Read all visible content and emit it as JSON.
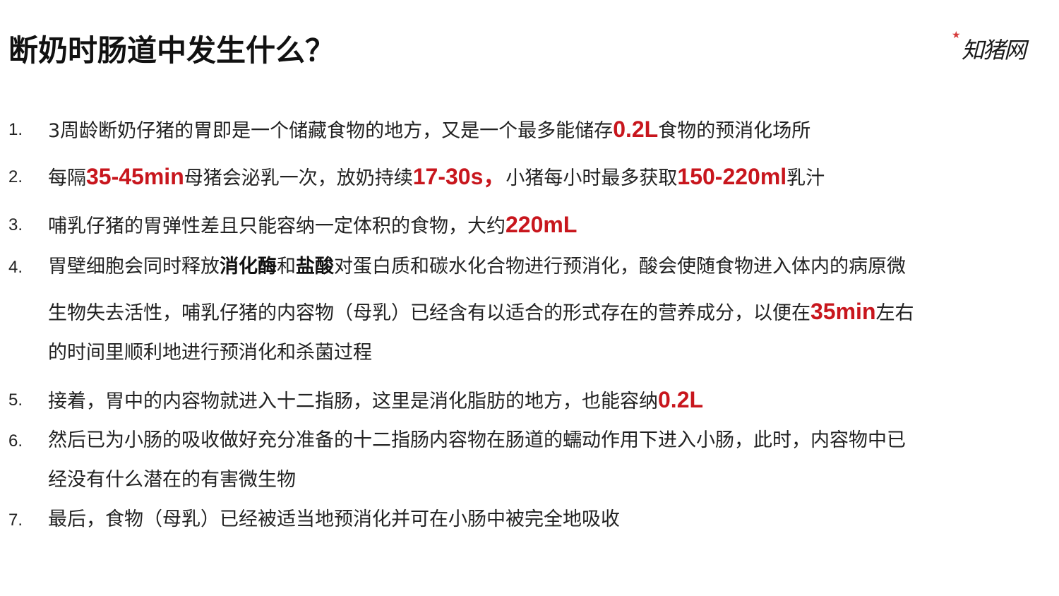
{
  "title": "断奶时肠道中发生什么？",
  "logo": {
    "text": "知猪网",
    "icon": "red-star-icon",
    "star_color": "#d63a3a"
  },
  "colors": {
    "highlight": "#c8161d",
    "text": "#222222"
  },
  "items": [
    {
      "number": "1.",
      "l1": {
        "a": "3周龄断奶仔猪的胃即是一个储藏食物的地方，又是一个最多能储存",
        "h1": "0.2L",
        "b": "食物的预消化场所"
      }
    },
    {
      "number": "2.",
      "l1": {
        "a": "每隔",
        "h1": "35-45min",
        "b": "母猪会泌乳一次，放奶持续",
        "h2": "17-30s，",
        "c": "小猪每小时最多获取",
        "h3": "150-220ml",
        "d": "乳汁"
      }
    },
    {
      "number": "3.",
      "l1": {
        "a": "哺乳仔猪的胃弹性差且只能容纳一定体积的食物，大约",
        "h1": "220mL"
      }
    },
    {
      "number": "4.",
      "l1": {
        "a": "胃壁细胞会同时释放",
        "b1": "消化酶",
        "b": "和",
        "b2": "盐酸",
        "c": "对蛋白质和碳水化合物进行预消化，酸会使随食物进入体内的病原微"
      },
      "l2": {
        "a": "生物失去活性，哺乳仔猪的内容物（母乳）已经含有以适合的形式存在的营养成分，以便在",
        "h1": "35min",
        "b": "左右"
      },
      "l3": {
        "a": "的时间里顺利地进行预消化和杀菌过程"
      }
    },
    {
      "number": "5.",
      "l1": {
        "a": "接着，胃中的内容物就进入十二指肠，这里是消化脂肪的地方，也能容纳",
        "h1": "0.2L"
      }
    },
    {
      "number": "6.",
      "l1": {
        "a": "然后已为小肠的吸收做好充分准备的十二指肠内容物在肠道的蠕动作用下进入小肠，此时，内容物中已"
      },
      "l2": {
        "a": "经没有什么潜在的有害微生物"
      }
    },
    {
      "number": "7.",
      "l1": {
        "a": "最后，食物（母乳）已经被适当地预消化并可在小肠中被完全地吸收"
      }
    }
  ]
}
